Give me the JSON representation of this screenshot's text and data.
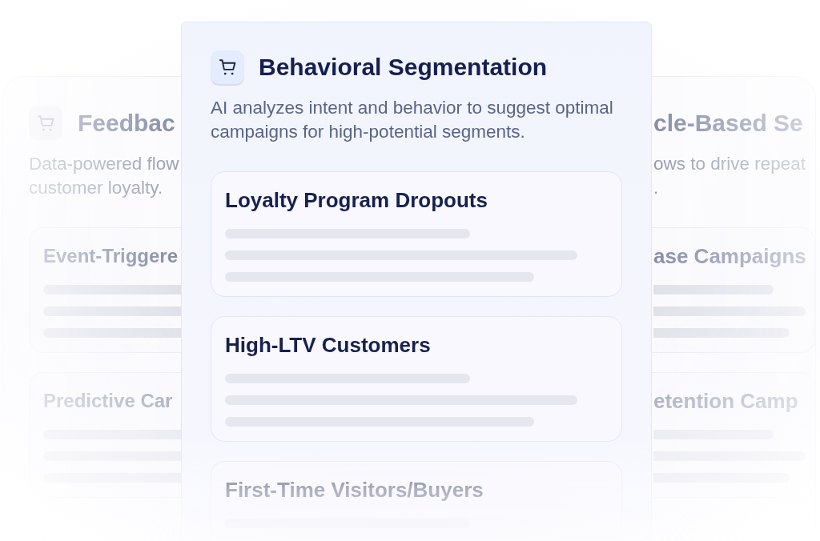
{
  "left_card": {
    "title": "Feedbac",
    "description_lines": [
      "Data-powered flow",
      "customer loyalty."
    ],
    "segments": [
      {
        "title": "Event-Triggere"
      },
      {
        "title": "Predictive Car"
      }
    ]
  },
  "main_card": {
    "title": "Behavioral Segmentation",
    "description": "AI analyzes intent and behavior to suggest optimal campaigns for high-potential segments.",
    "segments": [
      {
        "title": "Loyalty Program Dropouts"
      },
      {
        "title": "High-LTV Customers"
      },
      {
        "title": "First-Time Visitors/Buyers"
      }
    ]
  },
  "right_card": {
    "title": "cle-Based Se",
    "description_lines": [
      "ows to drive repeat",
      "."
    ],
    "segments": [
      {
        "title": "ase Campaigns"
      },
      {
        "title": "etention Camp"
      }
    ]
  }
}
